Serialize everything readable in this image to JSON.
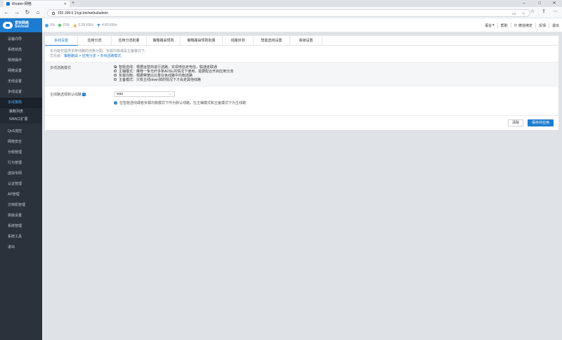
{
  "browser": {
    "tab_title": "iRouter-网络",
    "url": "192.168.0.1/cgi-bin/webui/admin"
  },
  "brand": {
    "name_cn": "爱快网络",
    "name_en": "Socloud"
  },
  "sidebar": {
    "items": [
      "设备向导",
      "系统状态",
      "常用操作",
      "网络设置",
      "无线设置",
      "多线设置"
    ],
    "active": "多线策略",
    "subitems": [
      "策略列表",
      "WAN口扩展"
    ],
    "items_after": [
      "QoS流控",
      "网络安全",
      "分组管理",
      "行为管理",
      "虚拟专网",
      "认证管理",
      "AP管理",
      "文档机管理",
      "高级设置",
      "系统管理",
      "系统工具",
      "退出"
    ]
  },
  "topbar": {
    "cpu": "3%",
    "mem": "23%",
    "up": "3.28 KB/s",
    "down": "4.83 KB/s",
    "links": [
      "语言",
      "帮助",
      "微信绑定",
      "反馈",
      "退出"
    ]
  },
  "tabs": [
    "多线设置",
    "应用分流",
    "应用分流批量",
    "策略路由规则",
    "策略路由规则批量",
    "线路侦测",
    "智能选线设置",
    "高级设置"
  ],
  "description": {
    "line1": "本功能仅提供多条线路的流量分配、负载均衡或是主备模式下。",
    "line2_prefix": "优先级：",
    "line2_path": "策略路由 > 应用分流 > 多线选路模式"
  },
  "form": {
    "mode_label": "多线选路模式",
    "options": [
      "智能选线：根据运营商进行选路，实现电信走电信，联通走联通",
      "主辅模式：推荐一条光纤多条ADSL的情况下使用，需要配合开启应用分流",
      "负载均衡：根据带宽比比重在各线路中均衡选路",
      "主备模式：只有主线down掉的情况下才会走其他线路"
    ],
    "selected_index": 0,
    "default_label": "主线路选择默认线路",
    "default_value": "wan",
    "tip": "在智能选线或者负载均衡模式下作为默认线路，在主辅模式和主备模式下为主线路"
  },
  "buttons": {
    "clear": "清除",
    "save": "保存并应用"
  },
  "colors": {
    "accent": "#1c7ccf",
    "sidebar_bg": "#2b323c"
  }
}
